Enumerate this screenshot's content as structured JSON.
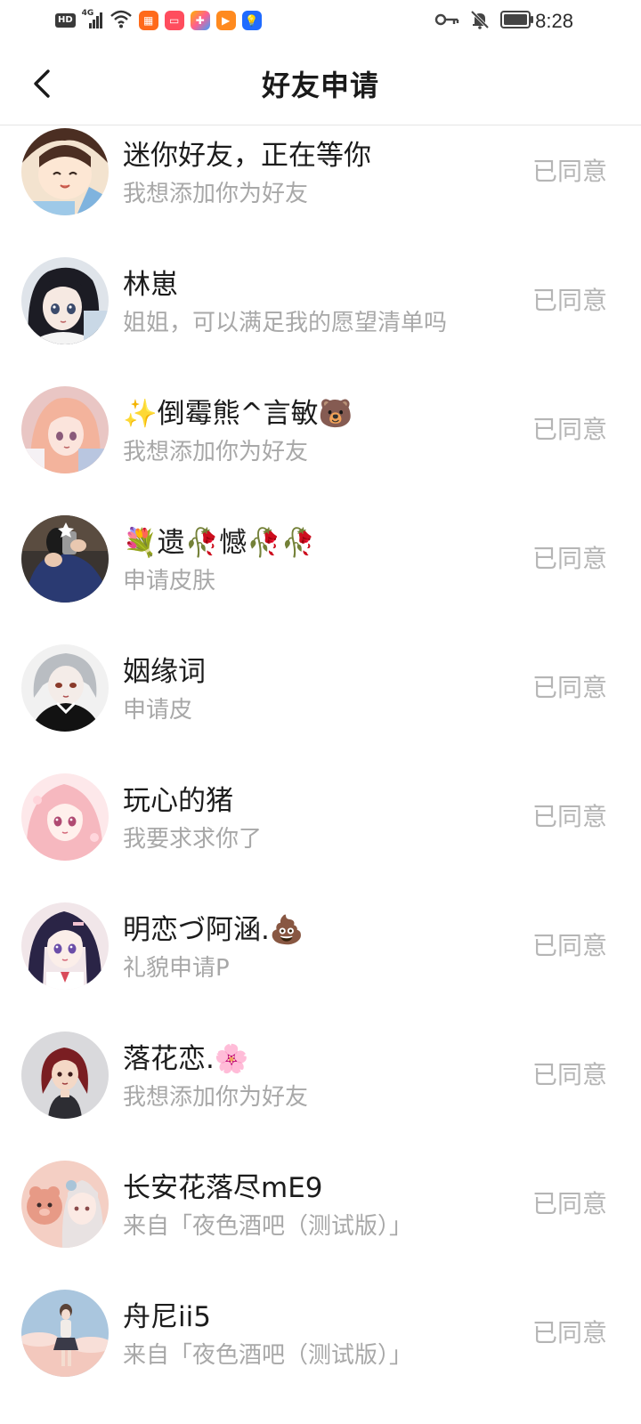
{
  "status_bar": {
    "hd": "HD",
    "network": "4G",
    "time": "8:28"
  },
  "header": {
    "title": "好友申请"
  },
  "requests": [
    {
      "name": "迷你好友，正在等你",
      "message": "我想添加你为好友",
      "status": "已同意"
    },
    {
      "name": "林崽",
      "message": "姐姐，可以满足我的愿望清单吗",
      "status": "已同意"
    },
    {
      "name": "✨倒霉熊^言敏🐻",
      "message": "我想添加你为好友",
      "status": "已同意"
    },
    {
      "name": "💐遗🥀憾🥀🥀",
      "message": "申请皮肤",
      "status": "已同意"
    },
    {
      "name": "姻缘词",
      "message": "申请皮",
      "status": "已同意"
    },
    {
      "name": "玩心的猪",
      "message": "我要求求你了",
      "status": "已同意"
    },
    {
      "name": "明恋づ阿涵.💩",
      "message": "礼貌申请P",
      "status": "已同意"
    },
    {
      "name": "落花恋.🌸",
      "message": "我想添加你为好友",
      "status": "已同意"
    },
    {
      "name": "长安花落尽mE9",
      "message": "来自「夜色酒吧（测试版）」",
      "status": "已同意"
    },
    {
      "name": "舟尼ii5",
      "message": "来自「夜色酒吧（测试版）」",
      "status": "已同意"
    }
  ]
}
